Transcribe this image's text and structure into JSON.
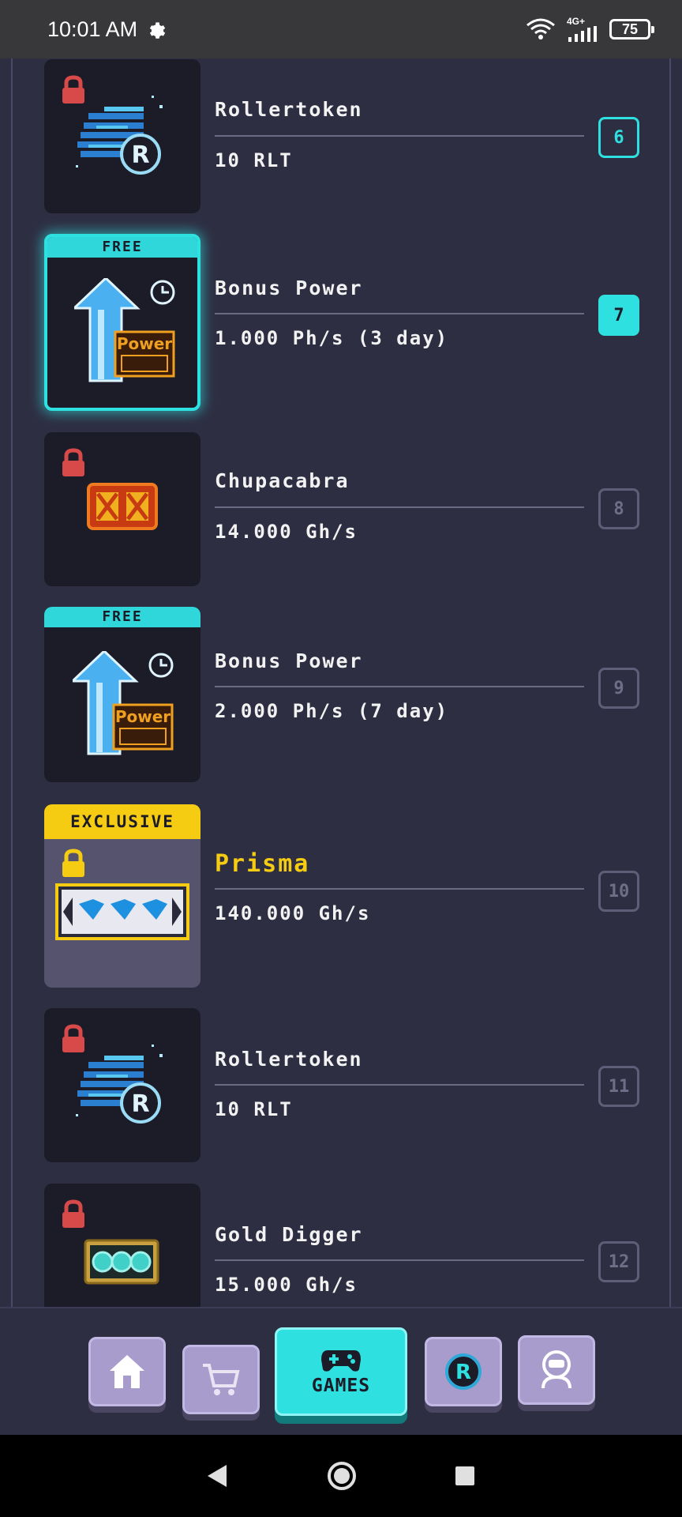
{
  "status_bar": {
    "time": "10:01 AM",
    "network": "4G+",
    "battery": "75"
  },
  "rewards": [
    {
      "name": "Rollertoken",
      "value": "10 RLT",
      "step": "6",
      "locked": true,
      "tag": ""
    },
    {
      "name": "Bonus Power",
      "value": "1.000 Ph/s (3 day)",
      "step": "7",
      "locked": false,
      "tag": "FREE"
    },
    {
      "name": "Chupacabra",
      "value": "14.000 Gh/s",
      "step": "8",
      "locked": true,
      "tag": ""
    },
    {
      "name": "Bonus Power",
      "value": "2.000 Ph/s (7 day)",
      "step": "9",
      "locked": false,
      "tag": "FREE"
    },
    {
      "name": "Prisma",
      "value": "140.000 Gh/s",
      "step": "10",
      "locked": true,
      "tag": "EXCLUSIVE"
    },
    {
      "name": "Rollertoken",
      "value": "10 RLT",
      "step": "11",
      "locked": true,
      "tag": ""
    },
    {
      "name": "Gold Digger",
      "value": "15.000 Gh/s",
      "step": "12",
      "locked": true,
      "tag": ""
    }
  ],
  "bottom_nav": {
    "games_label": "GAMES",
    "icons": [
      "home-icon",
      "cart-icon",
      "gamepad-icon",
      "rollercoin-icon",
      "profile-icon"
    ]
  },
  "colors": {
    "accent": "#2fe0e0",
    "exclusive": "#f6cc12",
    "lock": "#d84a4a",
    "background": "#2e2e42"
  }
}
